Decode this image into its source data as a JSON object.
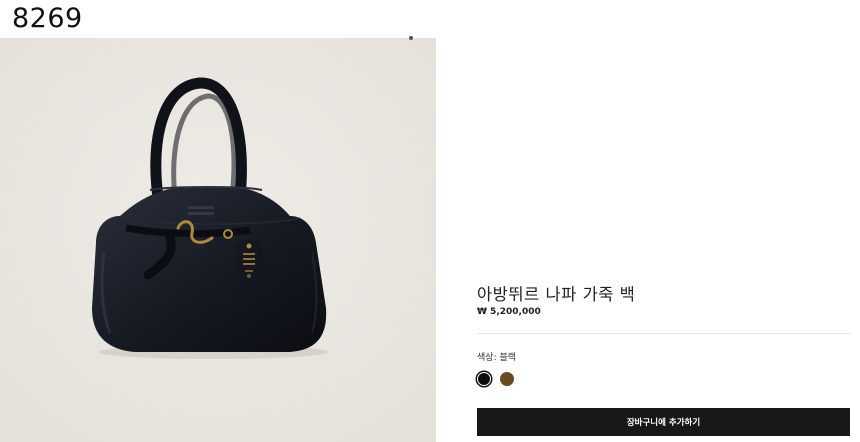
{
  "page": {
    "number": "8269"
  },
  "product": {
    "name": "아방뛰르 나파 가죽 백",
    "price": "₩ 5,200,000",
    "image_alt": "black leather tote bag",
    "color_label": "색상",
    "color_value": "블랙",
    "swatches": [
      {
        "name": "black",
        "color": "#0d0d0d",
        "selected": true
      },
      {
        "name": "brown",
        "color": "#6b4a22",
        "selected": false
      }
    ]
  },
  "actions": {
    "add_to_cart": "장바구니에 추가하기"
  }
}
